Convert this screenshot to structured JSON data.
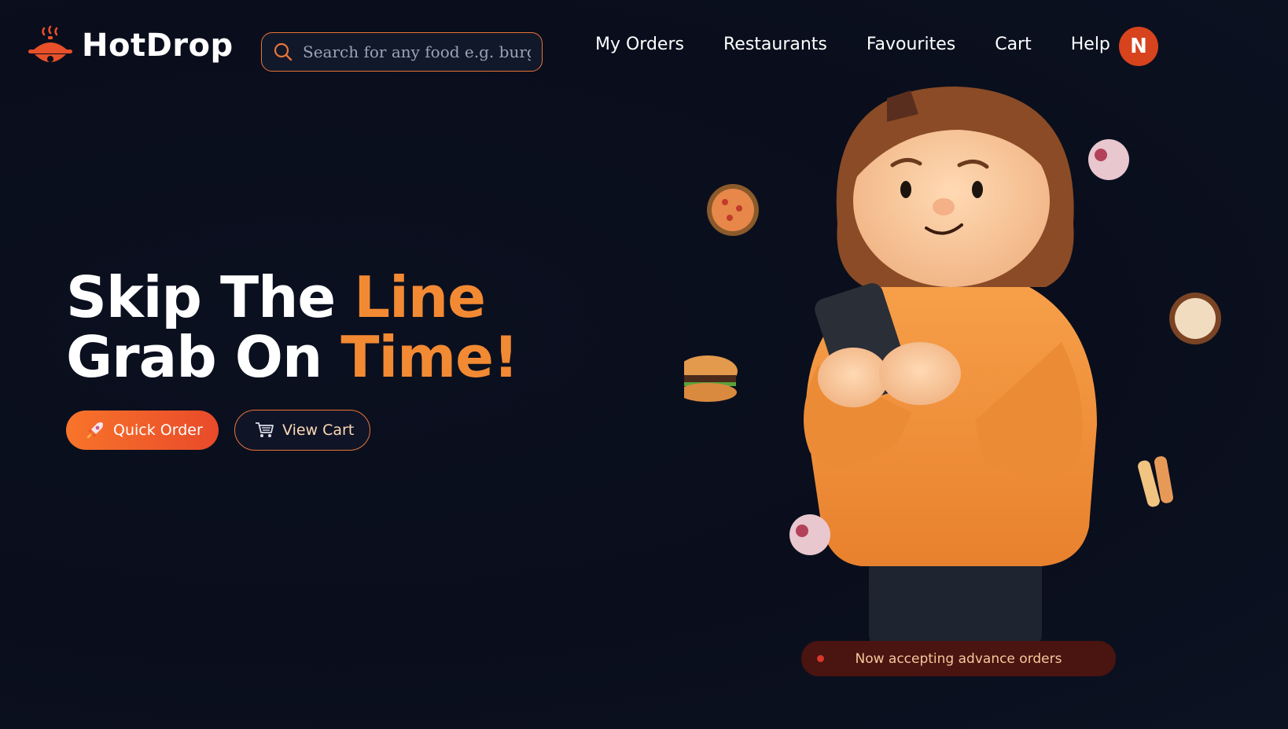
{
  "brand": {
    "name": "HotDrop",
    "accent": "#f28a33",
    "brand_red": "#d6431d"
  },
  "search": {
    "placeholder": "Search for any food e.g. burger"
  },
  "nav": {
    "items": [
      "My Orders",
      "Restaurants",
      "Favourites",
      "Cart",
      "Help"
    ]
  },
  "user": {
    "initial": "N"
  },
  "hero": {
    "line1_white": "Skip The ",
    "line1_orange": "Line",
    "line2_white": "Grab On ",
    "line2_orange": "Time!"
  },
  "buttons": {
    "quick_order": {
      "label": "Quick Order",
      "icon": "rocket-icon"
    },
    "view_cart": {
      "label": "View Cart",
      "icon": "cart-icon"
    }
  },
  "status_pill": {
    "text": "Now accepting advance orders"
  }
}
